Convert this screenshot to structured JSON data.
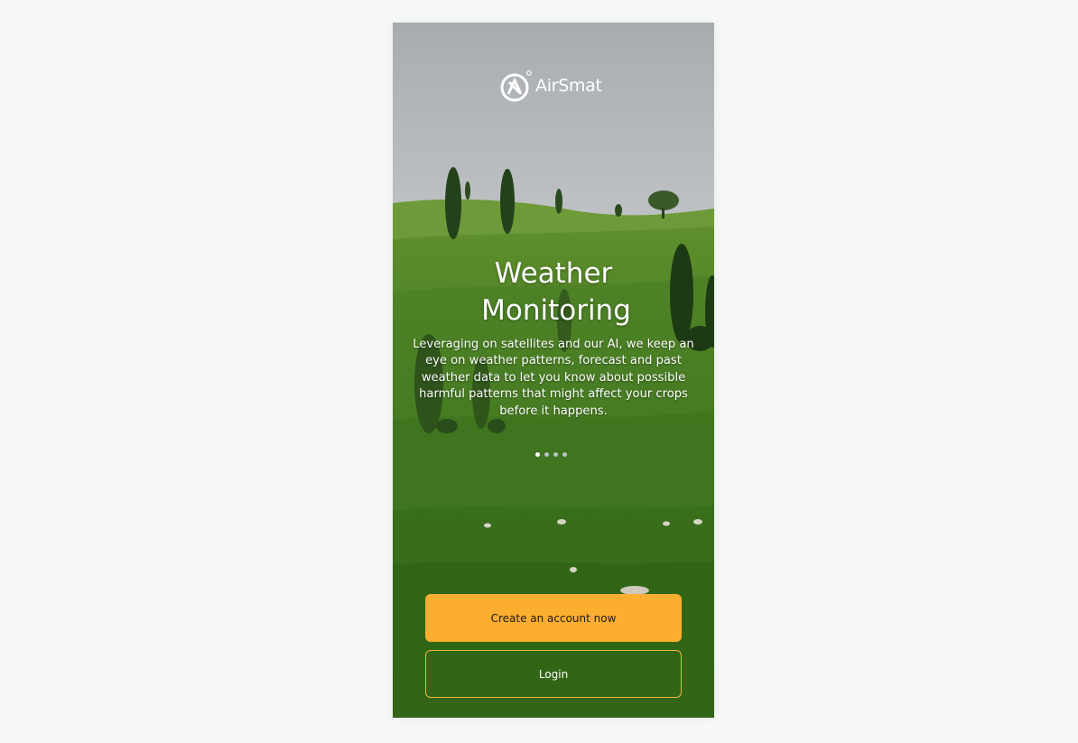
{
  "brand": {
    "name": "AirSmat",
    "logo_icon": "airsmat-logo-icon"
  },
  "slide": {
    "title_line1": "Weather",
    "title_line2": "Monitoring",
    "description": "Leveraging on satellites and our AI, we keep an eye on weather patterns, forecast and past weather data to let you know about possible harmful patterns that might affect your crops before it happens."
  },
  "pagination": {
    "count": 4,
    "active_index": 0
  },
  "buttons": {
    "create_account_label": "Create an account now",
    "login_label": "Login"
  },
  "colors": {
    "primary": "#fcae30",
    "login_border": "#f2b53a",
    "page_background": "#f6f8f7"
  }
}
